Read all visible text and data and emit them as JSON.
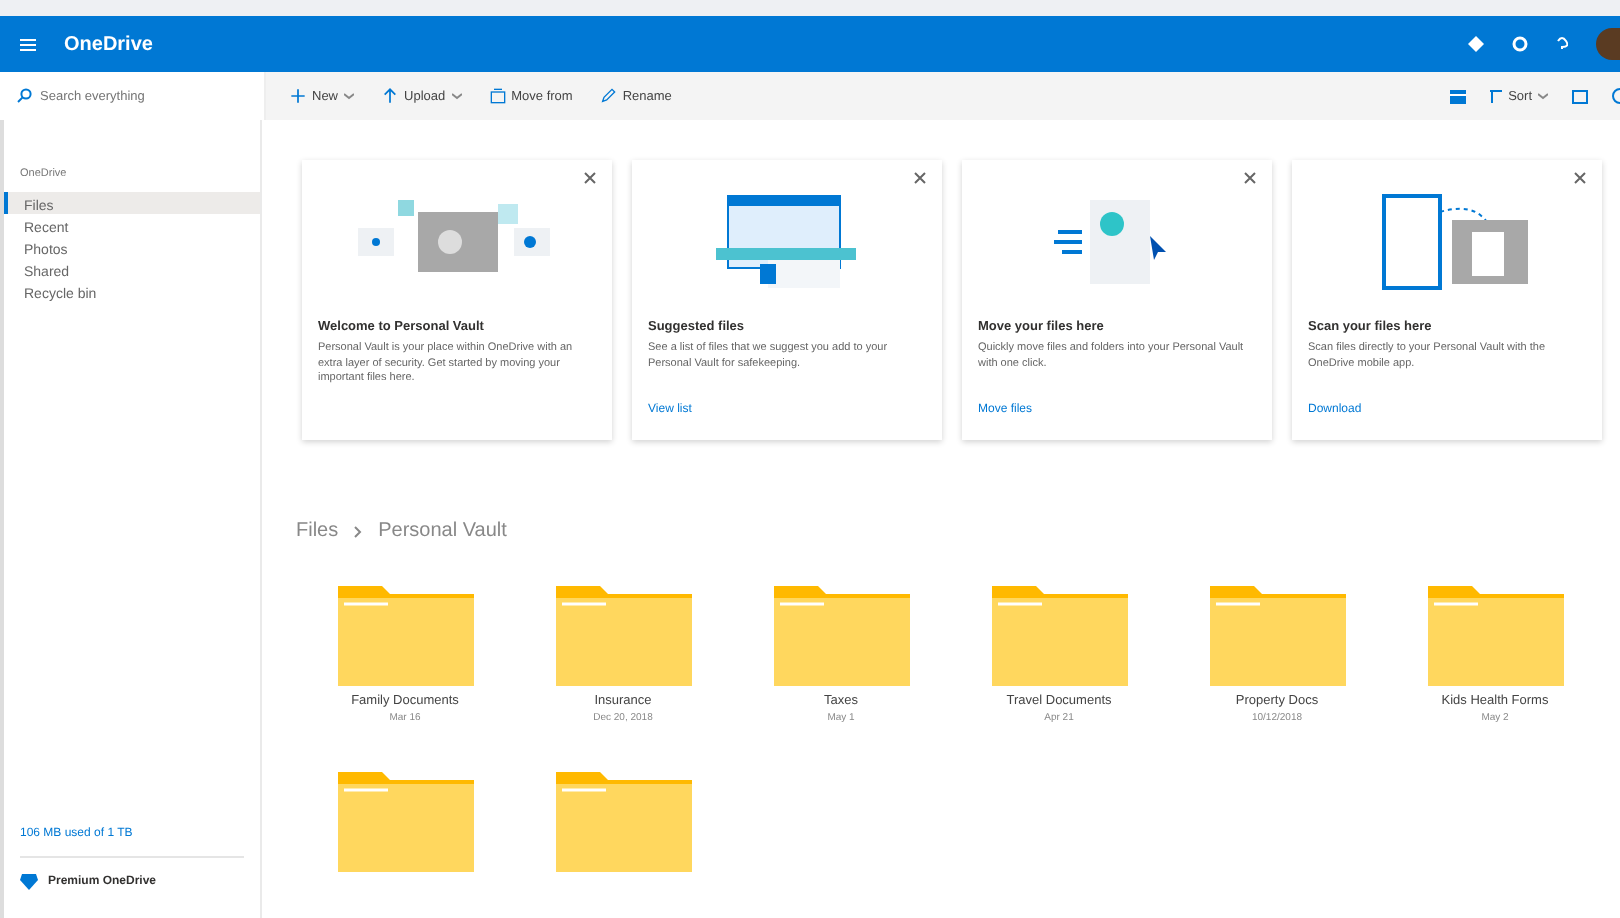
{
  "header": {
    "app_name": "OneDrive"
  },
  "search": {
    "placeholder": "Search everything"
  },
  "toolbar": {
    "actions": [
      {
        "label": "New",
        "dropdown": true
      },
      {
        "label": "Upload",
        "dropdown": true
      },
      {
        "label": "Move from",
        "dropdown": false
      },
      {
        "label": "Rename",
        "dropdown": false
      }
    ],
    "sort": "Sort"
  },
  "sidebar": {
    "heading": "OneDrive",
    "items": [
      {
        "label": "Files",
        "selected": true
      },
      {
        "label": "Recent",
        "selected": false
      },
      {
        "label": "Photos",
        "selected": false
      },
      {
        "label": "Shared",
        "selected": false
      },
      {
        "label": "Recycle bin",
        "selected": false
      }
    ],
    "storage": "106 MB used of 1 TB",
    "premium": "Premium OneDrive"
  },
  "cards": [
    {
      "kind": "vault",
      "title": "Welcome to Personal Vault",
      "text": "Personal Vault is your place within OneDrive with an extra layer of security. Get started by moving your important files here."
    },
    {
      "kind": "suggest",
      "title": "Suggested files",
      "text": "See a list of files that we suggest you add to your Personal Vault for safekeeping.",
      "link": "View list"
    },
    {
      "kind": "move",
      "title": "Move your files here",
      "text": "Quickly move files and folders into your Personal Vault with one click.",
      "link": "Move files"
    },
    {
      "kind": "scan",
      "title": "Scan your files here",
      "text": "Scan files directly to your Personal Vault with the OneDrive mobile app.",
      "link": "Download"
    }
  ],
  "breadcrumb": [
    "Files",
    "Personal Vault"
  ],
  "folders": [
    {
      "kind": "named",
      "name": "Family Documents",
      "date": "Mar 16"
    },
    {
      "kind": "named",
      "name": "Insurance",
      "date": "Dec 20, 2018"
    },
    {
      "kind": "named",
      "name": "Taxes",
      "date": "May 1"
    },
    {
      "kind": "named",
      "name": "Travel Documents",
      "date": "Apr 21"
    },
    {
      "kind": "named",
      "name": "Property Docs",
      "date": "10/12/2018"
    },
    {
      "kind": "named",
      "name": "Kids Health Forms",
      "date": "May 2"
    },
    {
      "kind": "cut"
    },
    {
      "kind": "cut"
    }
  ]
}
